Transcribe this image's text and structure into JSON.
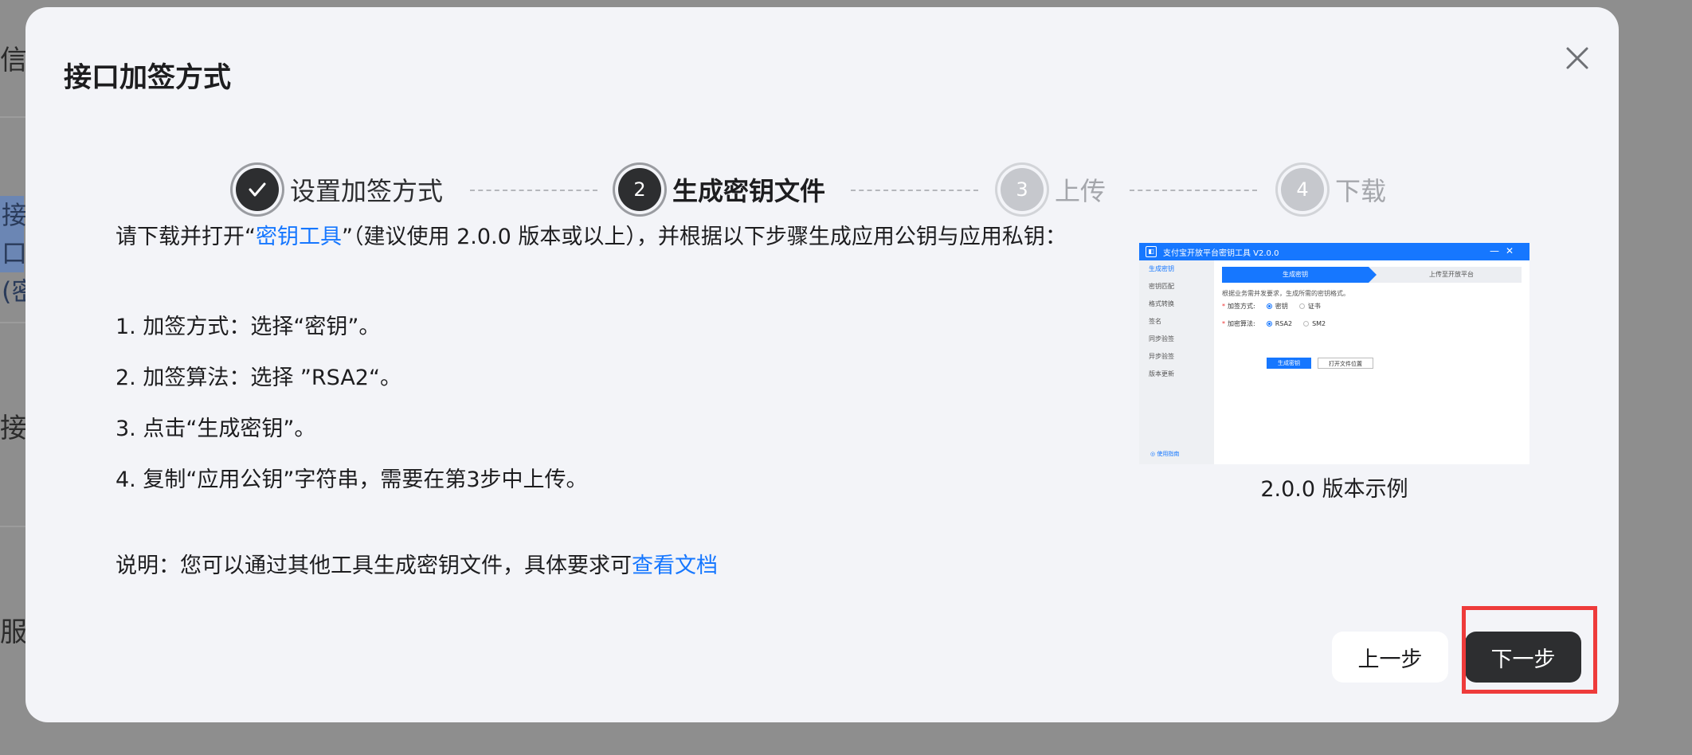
{
  "background": {
    "fragments": [
      "信",
      "接口",
      "(密",
      "接口",
      "服务"
    ]
  },
  "dialog": {
    "title": "接口加签方式",
    "steps": [
      {
        "label": "设置加签方式",
        "status": "done",
        "number": ""
      },
      {
        "label": "生成密钥文件",
        "status": "current",
        "number": "2"
      },
      {
        "label": "上传",
        "status": "pending",
        "number": "3"
      },
      {
        "label": "下载",
        "status": "pending",
        "number": "4"
      }
    ],
    "instructions": {
      "intro_before": "请下载并打开“",
      "intro_link": "密钥工具",
      "intro_after": "”（建议使用 2.0.0 版本或以上），并根据以下步骤生成应用公钥与应用私钥：",
      "items": [
        "1. 加签方式：选择“密钥”。",
        "2. 加签算法：选择 ”RSA2“。",
        "3. 点击“生成密钥”。",
        "4. 复制“应用公钥”字符串，需要在第3步中上传。"
      ],
      "note_before": "说明：您可以通过其他工具生成密钥文件，具体要求可",
      "note_link": "查看文档"
    },
    "preview": {
      "window_title": "支付宝开放平台密钥工具 V2.0.0",
      "sidebar": [
        "生成密钥",
        "密钥匹配",
        "格式转换",
        "签名",
        "同步验签",
        "异步验签",
        "版本更新"
      ],
      "help": "使用指南",
      "step1": "生成密钥",
      "step2": "上传至开放平台",
      "desc": "根据业务需并发要求，生成所需的密钥格式。",
      "row1_label": "加签方式:",
      "row1_opt1": "密钥",
      "row1_opt2": "证书",
      "row2_label": "加密算法:",
      "row2_opt1": "RSA2",
      "row2_opt2": "SM2",
      "btn_generate": "生成密钥",
      "btn_open": "打开文件位置",
      "caption": "2.0.0 版本示例"
    },
    "buttons": {
      "prev": "上一步",
      "next": "下一步"
    },
    "colors": {
      "link": "#1677ff",
      "primary_button": "#2d2e30",
      "highlight": "#ee3b3b"
    }
  }
}
